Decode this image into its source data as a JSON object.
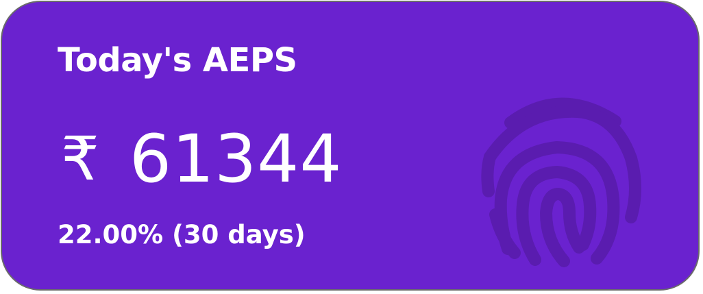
{
  "card": {
    "title": "Today's AEPS",
    "currency_symbol": "₹",
    "amount": "61344",
    "change": "22.00% (30 days)",
    "icon": "fingerprint-icon",
    "background_color": "#6a22cf",
    "icon_color": "#5a1caf"
  }
}
